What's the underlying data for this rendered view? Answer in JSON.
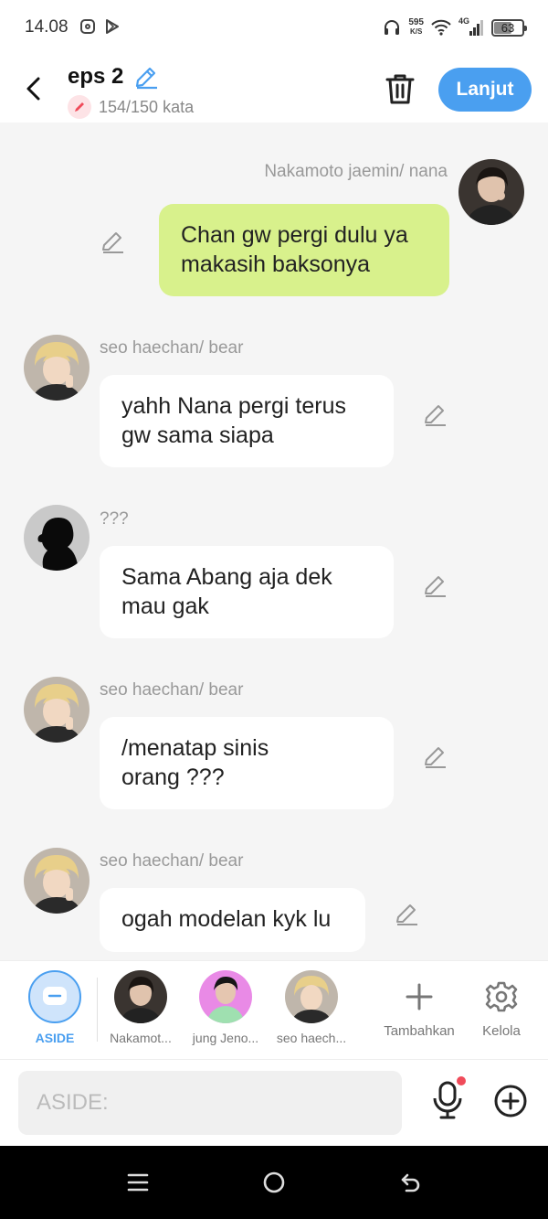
{
  "status_bar": {
    "time": "14.08",
    "net_speed_value": "595",
    "net_speed_unit": "K/S",
    "network_type": "4G",
    "battery": "63",
    "battery_level_percent": 63
  },
  "header": {
    "title": "eps 2",
    "word_count": "154/150 kata",
    "next_button": "Lanjut"
  },
  "messages": [
    {
      "side": "right",
      "name": "Nakamoto jaemin/ nana",
      "text_line1": "Chan gw pergi dulu ya",
      "text_line2": "makasih baksonya"
    },
    {
      "side": "left",
      "name": "seo haechan/ bear",
      "text_line1": "yahh Nana pergi terus",
      "text_line2": "gw sama siapa"
    },
    {
      "side": "left",
      "name": "???",
      "text_line1": "Sama Abang aja dek",
      "text_line2": "mau gak"
    },
    {
      "side": "left",
      "name": "seo haechan/ bear",
      "text_line1": "/menatap sinis",
      "text_line2": "orang ???"
    },
    {
      "side": "left",
      "name": "seo haechan/ bear",
      "text_line1": "ogah modelan kyk lu",
      "text_line2": ""
    }
  ],
  "characters": {
    "aside": "ASIDE",
    "items": [
      "Nakamot...",
      "jung Jeno...",
      "seo haech..."
    ],
    "add": "Tambahkan",
    "manage": "Kelola"
  },
  "input": {
    "placeholder": "ASIDE:"
  },
  "colors": {
    "accent": "#4a9ff0",
    "right_bubble": "#d8f18c",
    "left_bubble": "#ffffff",
    "background": "#f5f5f5"
  }
}
